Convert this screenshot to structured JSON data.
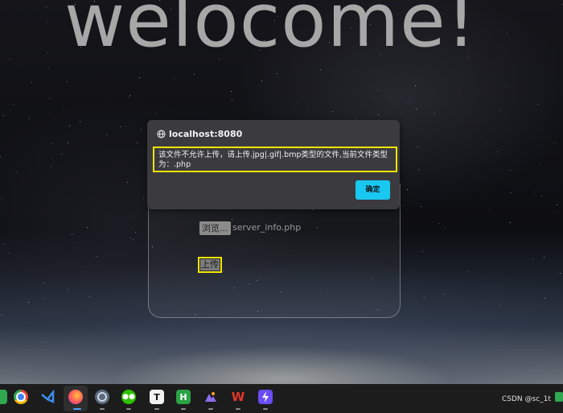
{
  "page": {
    "heading": "welocome!"
  },
  "dialog": {
    "origin": "localhost:8080",
    "message_line1": "该文件不允许上传，请上传.jpg|.gif|.bmp类型的文件,当前文件类型",
    "message_line2": "为：.php",
    "ok_label": "确定"
  },
  "form": {
    "browse_label": "浏览...",
    "file_name": "server_info.php",
    "upload_label": "上传"
  },
  "taskbar": {
    "icons": [
      "partial-app-icon",
      "chrome-icon",
      "vscode-icon",
      "firefox-icon",
      "settings-icon",
      "wechat-icon",
      "typora-icon",
      "hbuilder-icon",
      "app-icon",
      "wps-icon",
      "app-icon-2"
    ],
    "watermark": "CSDN @sc_1t"
  },
  "colors": {
    "highlight": "#f5e400",
    "ok_button": "#19c8f0",
    "dialog_bg": "#3b3b3f"
  }
}
